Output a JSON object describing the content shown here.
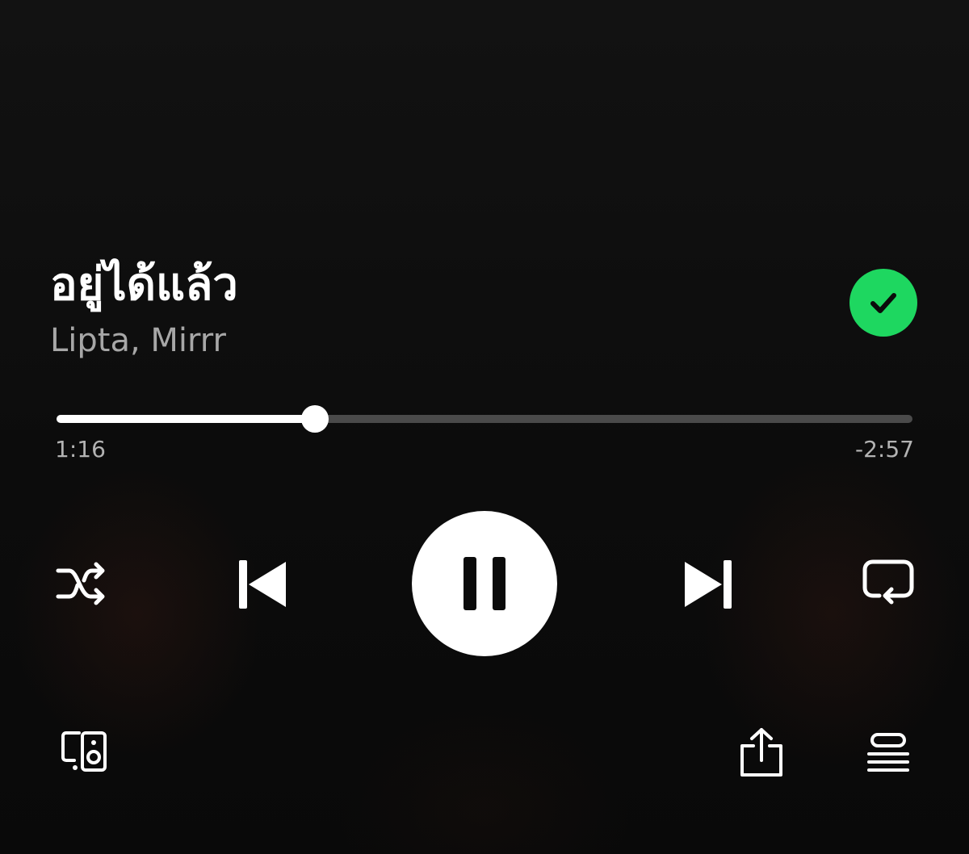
{
  "track": {
    "title": "อยู่ได้แล้ว",
    "artist": "Lipta, Mirrr",
    "liked": true
  },
  "playback": {
    "elapsed": "1:16",
    "remaining": "-2:57",
    "progress_fraction": 0.302,
    "state": "playing"
  },
  "icons": {
    "liked": "check-icon",
    "shuffle": "shuffle-icon",
    "previous": "skip-previous-icon",
    "play_pause": "pause-icon",
    "next": "skip-next-icon",
    "repeat": "repeat-icon",
    "devices": "connect-devices-icon",
    "share": "share-icon",
    "queue": "queue-icon"
  },
  "colors": {
    "accent": "#1ed760",
    "background": "#121212",
    "primary_text": "#ffffff",
    "secondary_text": "#a7a7a7",
    "progress_track": "#4a4a4a",
    "progress_fill": "#ffffff"
  }
}
